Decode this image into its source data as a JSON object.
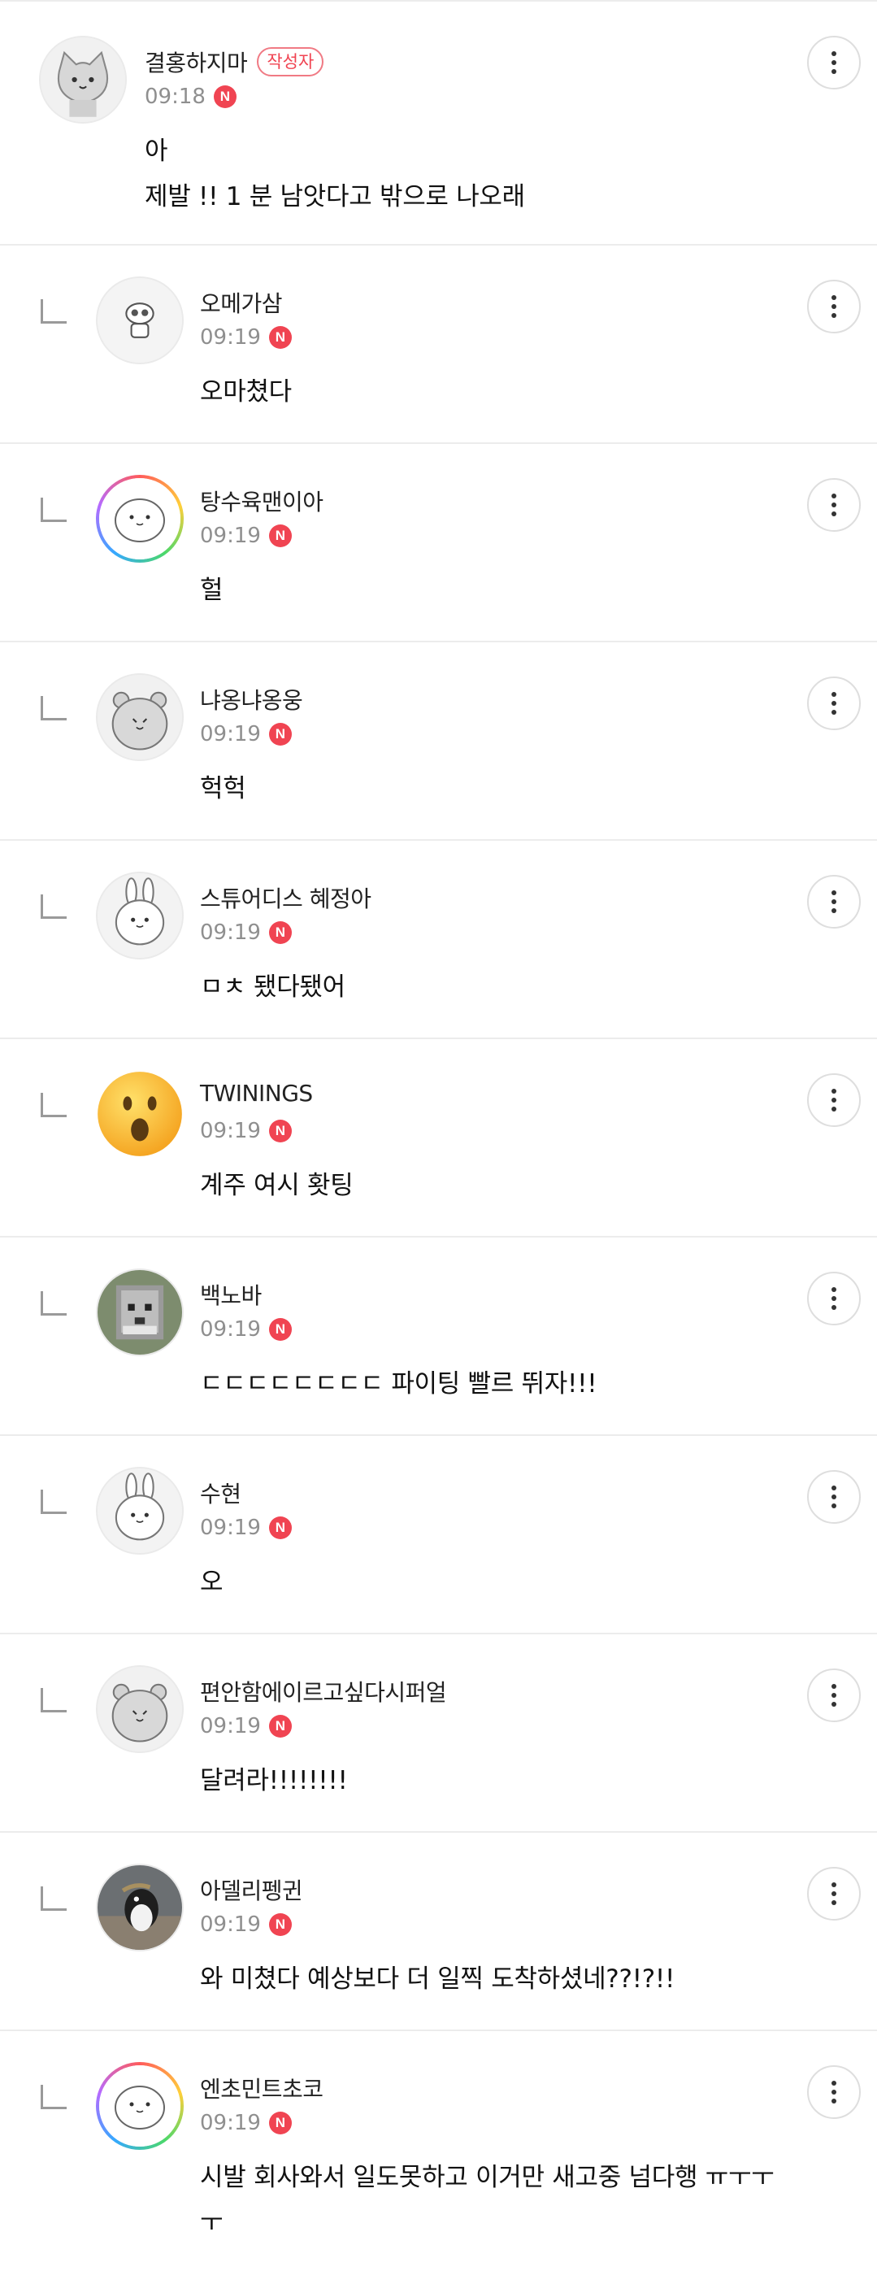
{
  "comments": [
    {
      "nickname": "결홍하지마",
      "author_badge": "작성자",
      "time": "09:18",
      "new_badge": "N",
      "body": "아\n제발 !! 1 분 남앗다고 밖으로 나오래",
      "avatar": "gray-cat-avatar",
      "reply": false
    },
    {
      "nickname": "오메가삼",
      "time": "09:19",
      "new_badge": "N",
      "body": "오마쳤다",
      "avatar": "small-character-avatar",
      "reply": true
    },
    {
      "nickname": "탕수육맨이아",
      "time": "09:19",
      "new_badge": "N",
      "body": "헐",
      "avatar": "white-blob-avatar",
      "reply": true
    },
    {
      "nickname": "냐옹냐옹웅",
      "time": "09:19",
      "new_badge": "N",
      "body": "헉헉",
      "avatar": "gray-bear-avatar",
      "reply": true
    },
    {
      "nickname": "스튜어디스 혜정아",
      "time": "09:19",
      "new_badge": "N",
      "body": "ㅁㅊ 됐다됐어",
      "avatar": "white-rabbit-avatar",
      "reply": true
    },
    {
      "nickname": "TWININGS",
      "time": "09:19",
      "new_badge": "N",
      "body": "계주 여시 홧팅",
      "avatar": "surprised-emoji-avatar",
      "reply": true
    },
    {
      "nickname": "백노바",
      "time": "09:19",
      "new_badge": "N",
      "body": "ㄷㄷㄷㄷㄷㄷㄷㄷ 파이팅 빨르 뛰자!!!",
      "avatar": "pixel-dog-avatar",
      "reply": true
    },
    {
      "nickname": "수현",
      "time": "09:19",
      "new_badge": "N",
      "body": "오",
      "avatar": "white-rabbit-avatar",
      "reply": true
    },
    {
      "nickname": "편안함에이르고싶다시퍼얼",
      "time": "09:19",
      "new_badge": "N",
      "body": "달려라!!!!!!!!",
      "avatar": "gray-bear-avatar",
      "reply": true
    },
    {
      "nickname": "아델리펭귄",
      "time": "09:19",
      "new_badge": "N",
      "body": "와 미쳤다 예상보다 더 일찍 도착하셨네??!?!!",
      "avatar": "penguin-photo-avatar",
      "reply": true
    },
    {
      "nickname": "엔초민트초코",
      "time": "09:19",
      "new_badge": "N",
      "body": "시발 회사와서 일도못하고 이거만 새고중 넘다행 ㅠㅜㅜ\nㅜ",
      "avatar": "white-blob-avatar",
      "reply": true
    }
  ],
  "more_icon": "more-vertical-icon",
  "colors": {
    "badge_red": "#f04452",
    "time_gray": "#8f8f8f",
    "divider": "#ececec"
  }
}
